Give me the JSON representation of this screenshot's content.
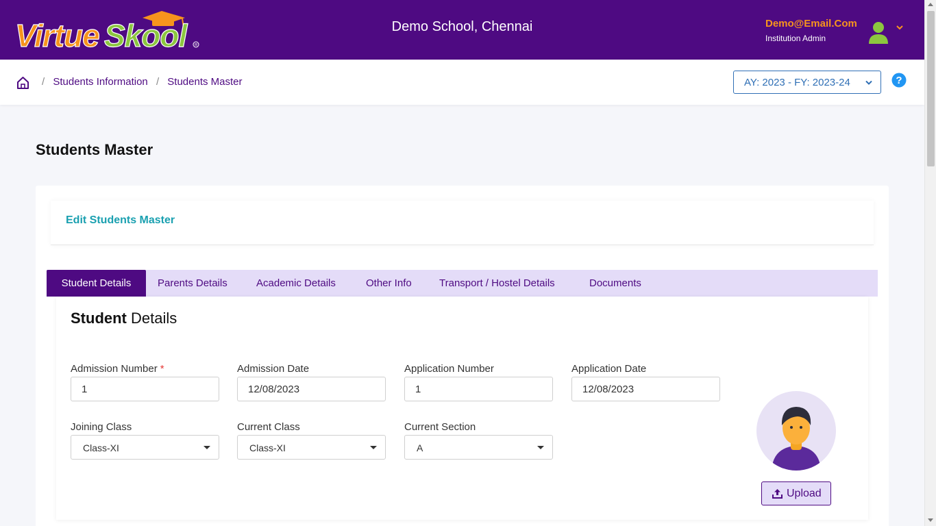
{
  "header": {
    "logo_text": "VirtueSkool",
    "school_name": "Demo School, Chennai",
    "user_email": "Demo@Email.Com",
    "user_role": "Institution Admin"
  },
  "breadcrumb": {
    "items": [
      "Students Information",
      "Students Master"
    ],
    "separator": "/"
  },
  "academic_year": {
    "selected": "AY: 2023 - FY: 2023-24"
  },
  "page": {
    "title": "Students Master",
    "card_title": "Edit Students Master"
  },
  "tabs": [
    {
      "label": "Student Details",
      "active": true
    },
    {
      "label": "Parents Details"
    },
    {
      "label": "Academic Details"
    },
    {
      "label": "Other Info"
    },
    {
      "label": "Transport / Hostel Details"
    },
    {
      "label": "Documents"
    }
  ],
  "section": {
    "title_bold": "Student",
    "title_rest": " Details"
  },
  "fields": {
    "admission_number": {
      "label": "Admission Number",
      "required_mark": "*",
      "value": "1"
    },
    "admission_date": {
      "label": "Admission Date",
      "value": "12/08/2023"
    },
    "application_number": {
      "label": "Application Number",
      "value": "1"
    },
    "application_date": {
      "label": "Application Date",
      "value": "12/08/2023"
    },
    "joining_class": {
      "label": "Joining Class",
      "value": "Class-XI"
    },
    "current_class": {
      "label": "Current Class",
      "value": "Class-XI"
    },
    "current_section": {
      "label": "Current Section",
      "value": "A"
    }
  },
  "upload": {
    "label": "Upload"
  },
  "colors": {
    "brand_purple": "#4e0a82",
    "tab_bg": "#e4dcf8",
    "accent_orange": "#f7941d",
    "accent_teal": "#1aa0b0",
    "link_blue": "#2f6fb5"
  }
}
